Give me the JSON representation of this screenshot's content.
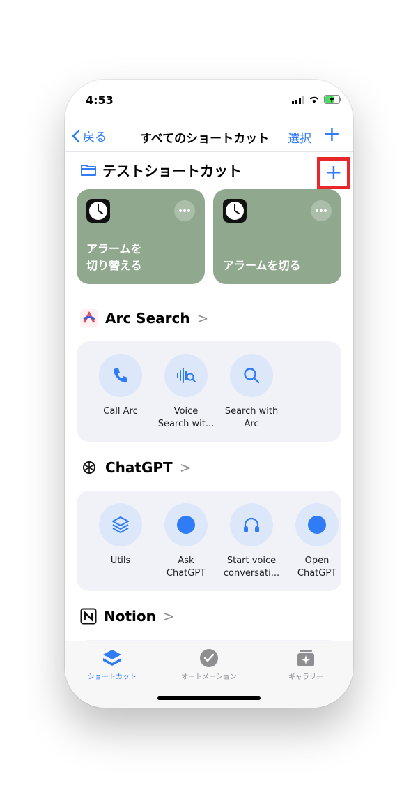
{
  "status": {
    "time": "4:53"
  },
  "nav": {
    "back": "戻る",
    "title": "すべてのショートカット",
    "select": "選択",
    "add": "+"
  },
  "folder": {
    "name": "テストショートカット",
    "add": "+"
  },
  "tiles": [
    {
      "label": "アラームを\n切り替える"
    },
    {
      "label": "アラームを切る"
    }
  ],
  "apps": [
    {
      "name": "Arc Search",
      "chevron": ">",
      "actions": [
        {
          "label": "Call Arc",
          "icon": "phone-icon"
        },
        {
          "label": "Voice\nSearch wit...",
          "icon": "voice-search-icon"
        },
        {
          "label": "Search with\nArc",
          "icon": "search-icon"
        }
      ]
    },
    {
      "name": "ChatGPT",
      "chevron": ">",
      "actions": [
        {
          "label": "Utils",
          "icon": "layers-icon"
        },
        {
          "label": "Ask\nChatGPT",
          "icon": "dot-icon"
        },
        {
          "label": "Start voice\nconversati...",
          "icon": "headphones-icon"
        },
        {
          "label": "Open\nChatGPT",
          "icon": "dot-icon"
        }
      ]
    },
    {
      "name": "Notion",
      "chevron": ">"
    }
  ],
  "tabs": [
    {
      "label": "ショートカット",
      "active": true
    },
    {
      "label": "オートメーション",
      "active": false
    },
    {
      "label": "ギャラリー",
      "active": false
    }
  ],
  "colors": {
    "accent": "#2f7cf6",
    "tile": "#8fa88e",
    "highlight": "#e8272b"
  }
}
